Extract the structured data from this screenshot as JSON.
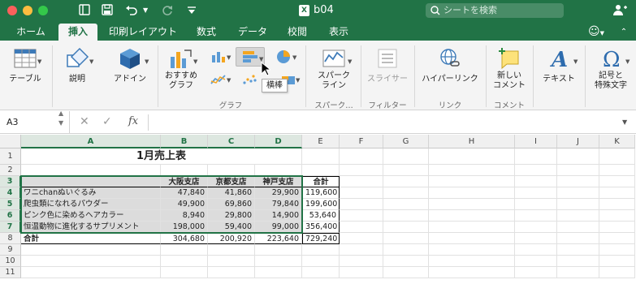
{
  "titlebar": {
    "doc_title": "b04",
    "doc_icon": "X",
    "search_placeholder": "シートを検索",
    "accent": "#217346"
  },
  "tabs": [
    "ホーム",
    "挿入",
    "印刷レイアウト",
    "数式",
    "データ",
    "校閲",
    "表示"
  ],
  "active_tab": "挿入",
  "ribbon": {
    "table": "テーブル",
    "illustrations": "説明",
    "addins": "アドイン",
    "recommended_charts": [
      "おすすめ",
      "グラフ"
    ],
    "group_chart": "グラフ",
    "sparklines": [
      "スパーク",
      "ライン"
    ],
    "group_sparklines": "スパーク…",
    "slicer": "スライサー",
    "group_filter": "フィルター",
    "hyperlink": "ハイパーリンク",
    "group_link": "リンク",
    "new_comment": [
      "新しい",
      "コメント"
    ],
    "group_comment": "コメント",
    "text": "テキスト",
    "symbols": [
      "記号と",
      "特殊文字"
    ],
    "tooltip": "横棒"
  },
  "formula_bar": {
    "name_box": "A3",
    "fx": "fx"
  },
  "columns": [
    "A",
    "B",
    "C",
    "D",
    "E",
    "F",
    "G",
    "H",
    "I",
    "J",
    "K"
  ],
  "selected_columns": [
    "A",
    "B",
    "C",
    "D"
  ],
  "rows": [
    "1",
    "2",
    "3",
    "4",
    "5",
    "6",
    "7",
    "8",
    "9",
    "10",
    "11"
  ],
  "selected_rows": [
    "3",
    "4",
    "5",
    "6",
    "7"
  ],
  "sheet": {
    "title": "1月売上表",
    "headers": [
      "大阪支店",
      "京都支店",
      "神戸支店",
      "合計"
    ],
    "items": [
      {
        "name": "ワニchanぬいぐるみ",
        "osaka": "47,840",
        "kyoto": "41,860",
        "kobe": "29,900",
        "total": "119,600"
      },
      {
        "name": "爬虫類になれるパウダー",
        "osaka": "49,900",
        "kyoto": "69,860",
        "kobe": "79,840",
        "total": "199,600"
      },
      {
        "name": "ピンク色に染めるヘアカラー",
        "osaka": "8,940",
        "kyoto": "29,800",
        "kobe": "14,900",
        "total": "53,640"
      },
      {
        "name": "恒温動物に進化するサプリメント",
        "osaka": "198,000",
        "kyoto": "59,400",
        "kobe": "99,000",
        "total": "356,400"
      }
    ],
    "total_row": {
      "name": "合計",
      "osaka": "304,680",
      "kyoto": "200,920",
      "kobe": "223,640",
      "total": "729,240"
    }
  }
}
